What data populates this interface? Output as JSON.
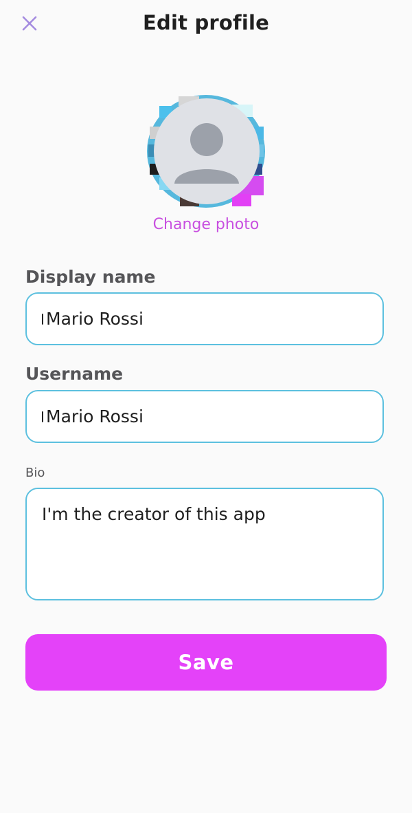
{
  "header": {
    "title": "Edit profile",
    "close_icon": "close-icon"
  },
  "avatar": {
    "icon": "user-placeholder-icon",
    "change_photo_label": "Change photo"
  },
  "form": {
    "display_name": {
      "label": "Display name",
      "value": "Mario Rossi"
    },
    "username": {
      "label": "Username",
      "value": "Mario Rossi"
    },
    "bio": {
      "label": "Bio",
      "value": "I'm the creator of this app"
    }
  },
  "actions": {
    "save_label": "Save"
  },
  "colors": {
    "accent": "#e442f9",
    "link": "#c84fe0",
    "field_border": "#5cc0df",
    "close_icon": "#a48be0"
  }
}
